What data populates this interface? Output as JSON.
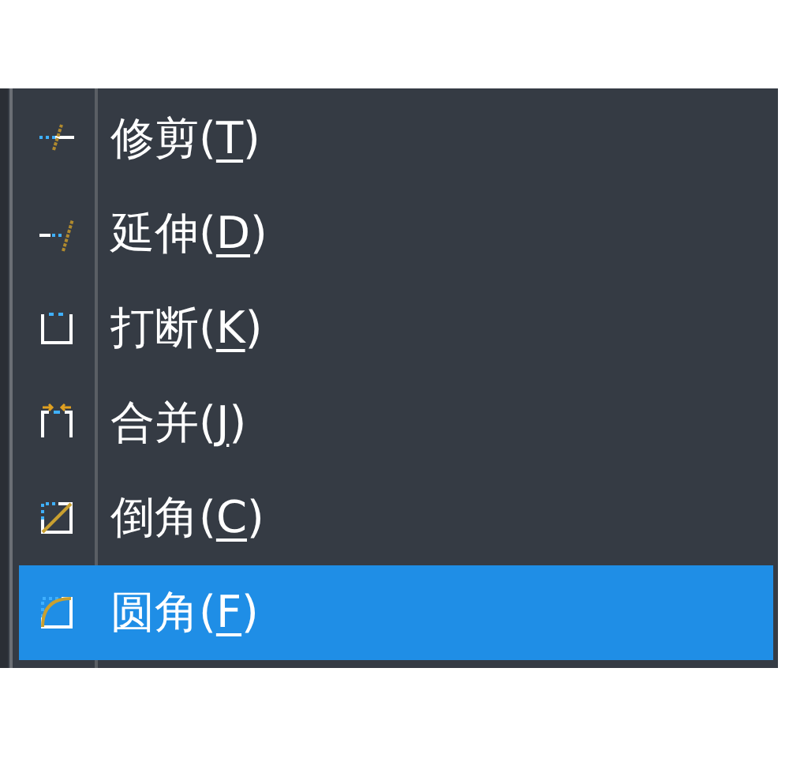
{
  "menu": {
    "items": [
      {
        "label": "修剪(T)",
        "kind": "trim",
        "selected": false
      },
      {
        "label": "延伸(D)",
        "kind": "extend",
        "selected": false
      },
      {
        "label": "打断(K)",
        "kind": "break",
        "selected": false
      },
      {
        "label": "合并(J)",
        "kind": "join",
        "selected": false
      },
      {
        "label": "倒角(C)",
        "kind": "chamfer",
        "selected": false
      },
      {
        "label": "圆角(F)",
        "kind": "fillet",
        "selected": true
      }
    ]
  }
}
